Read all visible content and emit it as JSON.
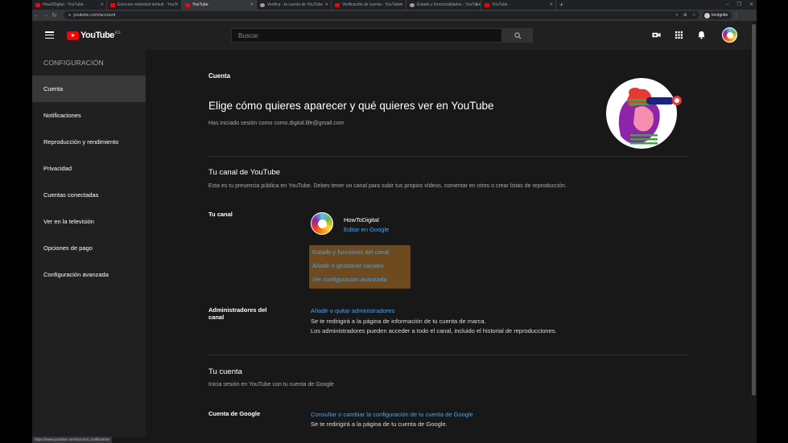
{
  "browser": {
    "tabs": [
      {
        "title": "How2Digital - YouTube",
        "active": false
      },
      {
        "title": "Exercise restricted default - YouT",
        "active": false
      },
      {
        "title": "YouTube",
        "active": true
      },
      {
        "title": "Verifica - la cuenta de YouTube",
        "active": false
      },
      {
        "title": "Verificación de cuenta - YouTube",
        "active": false
      },
      {
        "title": "Estado y funcionalidades - YouTube",
        "active": false
      },
      {
        "title": "YouTube",
        "active": false
      }
    ],
    "url": "youtube.com/account",
    "profile_label": "Incógnito",
    "status_url": "https://www.youtube.com/account_notifications"
  },
  "masthead": {
    "logo_text": "YouTube",
    "country_code": "ES",
    "search_placeholder": "Buscar"
  },
  "sidenav": {
    "heading": "CONFIGURACIÓN",
    "items": [
      {
        "label": "Cuenta",
        "active": true
      },
      {
        "label": "Notificaciones",
        "active": false
      },
      {
        "label": "Reproducción y rendimiento",
        "active": false
      },
      {
        "label": "Privacidad",
        "active": false
      },
      {
        "label": "Cuentas conectadas",
        "active": false
      },
      {
        "label": "Ver en la televisión",
        "active": false
      },
      {
        "label": "Opciones de pago",
        "active": false
      },
      {
        "label": "Configuración avanzada",
        "active": false
      }
    ]
  },
  "main": {
    "section_label": "Cuenta",
    "title": "Elige cómo quieres aparecer y qué quieres ver en YouTube",
    "signed_in_text": "Has iniciado sesión como como.digital.life@gmail.com",
    "channel_section": {
      "heading": "Tu canal de YouTube",
      "description": "Esta es tu presencia pública en YouTube. Debes tener un canal para subir tus propios vídeos, comentar en otros o crear listas de reproducción.",
      "your_channel_label": "Tu canal",
      "channel_name": "HowToDigital",
      "edit_link": "Editar en Google",
      "highlighted_links": [
        "Estado y funciones del canal",
        "Añadir o gestionar canales",
        "Ver configuración avanzada"
      ],
      "admins_label": "Administradores del canal",
      "admins_link": "Añadir o quitar administradores",
      "admins_note_1": "Se te redirigirá a la página de información de tu cuenta de marca.",
      "admins_note_2": "Los administradores pueden acceder a todo el canal, incluido el historial de reproducciones."
    },
    "account_section": {
      "heading": "Tu cuenta",
      "description": "Inicia sesión en YouTube con tu cuenta de Google",
      "google_label": "Cuenta de Google",
      "google_link": "Consultar o cambiar la configuración de tu cuenta de Google",
      "google_note": "Se te redirigirá a la página de tu cuenta de Google."
    }
  },
  "colors": {
    "youtube_red": "#ff0000",
    "link_blue": "#3ea6ff",
    "highlight_box": "#6e4a1e"
  }
}
